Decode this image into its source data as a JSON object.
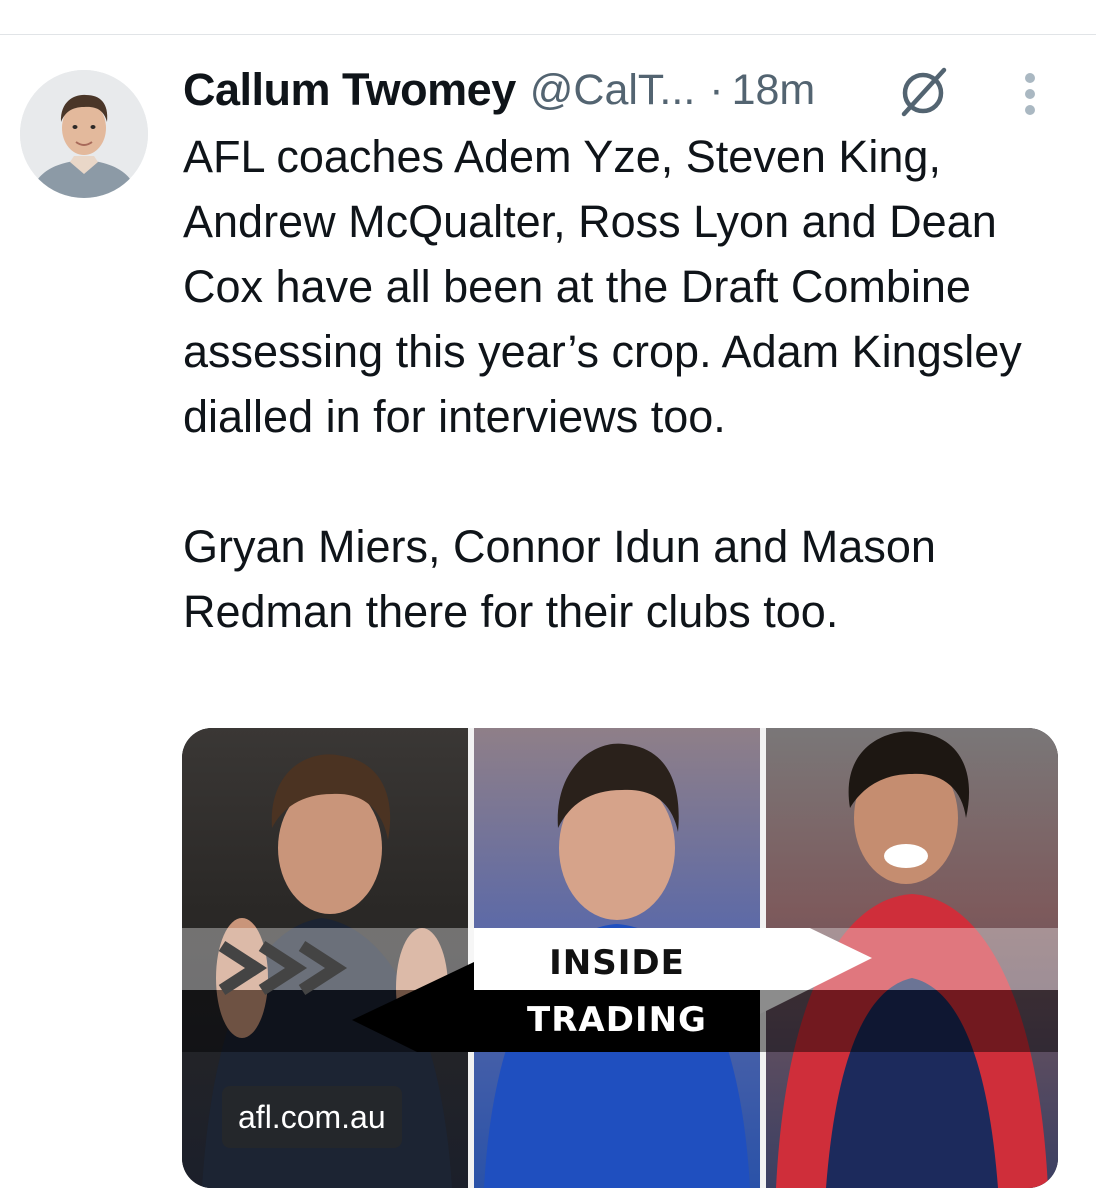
{
  "tweet": {
    "author_name": "Callum Twomey",
    "handle": "@CalT...",
    "separator": "·",
    "time": "18m",
    "text": "AFL coaches Adem Yze, Steven King, Andrew McQualter, Ross Lyon and Dean Cox have all been at the Draft Combine assessing this year’s crop. Adam Kingsley dialled in for interviews too.\n\nGryan Miers, Connor Idun and Mason Redman there for their clubs too."
  },
  "icons": {
    "avatar": "profile-photo",
    "grok": "grok-icon",
    "more": "more-vertical-icon"
  },
  "media": {
    "banner_line1": "INSIDE",
    "banner_line2": "TRADING",
    "source": "afl.com.au"
  },
  "colors": {
    "text_primary": "#0f1419",
    "text_secondary": "#536471",
    "divider": "#e1e4e7"
  }
}
